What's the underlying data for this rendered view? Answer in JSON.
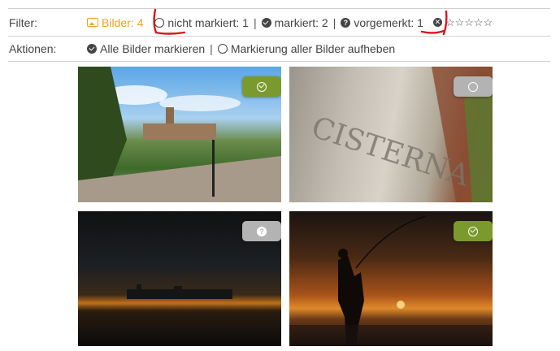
{
  "filter": {
    "label": "Filter:",
    "all": "Bilder: 4",
    "unmarked": "nicht markiert: 1",
    "marked": "markiert: 2",
    "reserved": "vorgemerkt: 1",
    "separator": "|",
    "clear_icon": "x-circle-icon",
    "stars": "☆☆☆☆☆"
  },
  "actions": {
    "label": "Aktionen:",
    "mark_all": "Alle Bilder markieren",
    "separator": "|",
    "unmark_all": "Markierung aller Bilder aufheben"
  },
  "colors": {
    "accent": "#f0a020",
    "marked_badge": "#7a9a2e",
    "unmarked_badge": "#b3b3b3",
    "annotation": "#d8161b"
  },
  "images": [
    {
      "subject": "hilltop town landscape",
      "status": "markiert",
      "badge_icon": "check-circle-icon"
    },
    {
      "subject": "CISTERNA stone inscription",
      "status": "nicht markiert",
      "badge_icon": "circle-icon"
    },
    {
      "subject": "dark sunset skyline",
      "status": "vorgemerkt",
      "badge_icon": "question-circle-icon"
    },
    {
      "subject": "fisherman at sunset",
      "status": "markiert",
      "badge_icon": "check-circle-icon"
    }
  ]
}
